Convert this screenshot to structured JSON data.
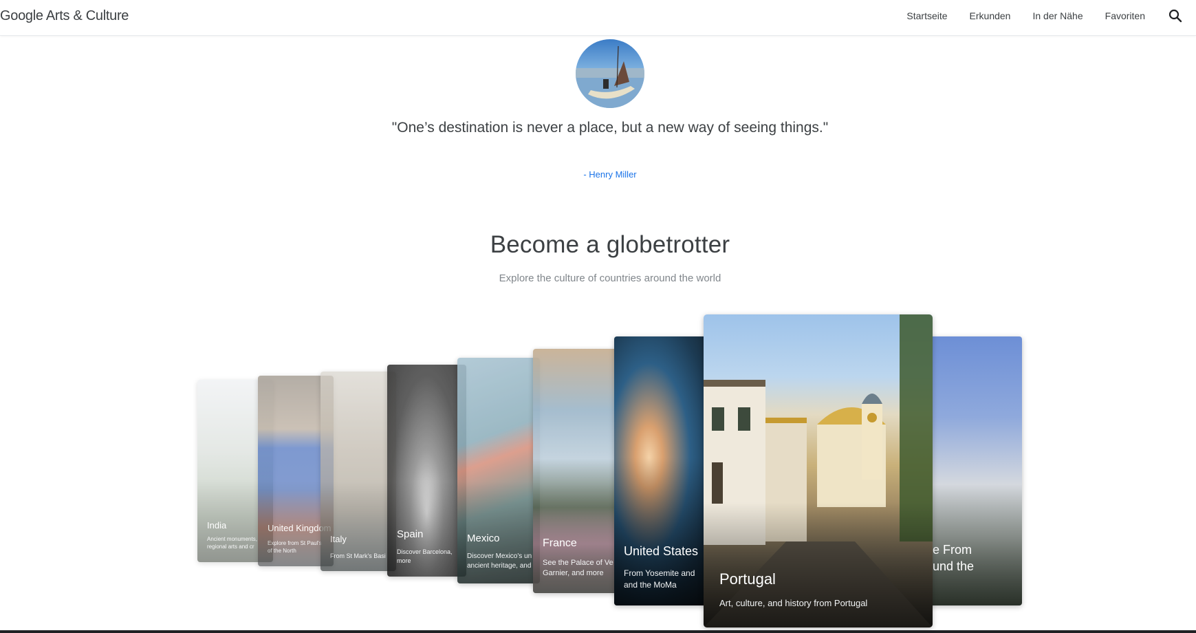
{
  "header": {
    "logo": "Google Arts & Culture",
    "nav": [
      "Startseite",
      "Erkunden",
      "In der Nähe",
      "Favoriten"
    ],
    "search_icon": "search-icon"
  },
  "quote": {
    "text": "\"One’s destination is never a place, but a new way of seeing things.\"",
    "author": "- Henry Miller"
  },
  "section": {
    "title": "Become a globetrotter",
    "subtitle": "Explore the culture of countries around the world"
  },
  "cards": [
    {
      "title": "India",
      "desc": "Ancient monuments, regional arts and cr"
    },
    {
      "title": "United Kingdom",
      "desc": "Explore from St Paul's of the North"
    },
    {
      "title": "Italy",
      "desc": "From St Mark's Basi"
    },
    {
      "title": "Spain",
      "desc": "Discover Barcelona, more"
    },
    {
      "title": "Mexico",
      "desc": "Discover Mexico's un ancient heritage, and"
    },
    {
      "title": "France",
      "desc": "See the Palace of Ve Garnier, and more"
    },
    {
      "title": "United States",
      "desc": "From Yosemite and and the MoMa"
    },
    {
      "title": "Portugal",
      "desc": "Art, culture, and history from Portugal"
    },
    {
      "title": "ore From round the",
      "desc": ""
    }
  ],
  "colors": {
    "accent": "#1a73e8",
    "text": "#3c4043",
    "muted": "#80868b"
  }
}
